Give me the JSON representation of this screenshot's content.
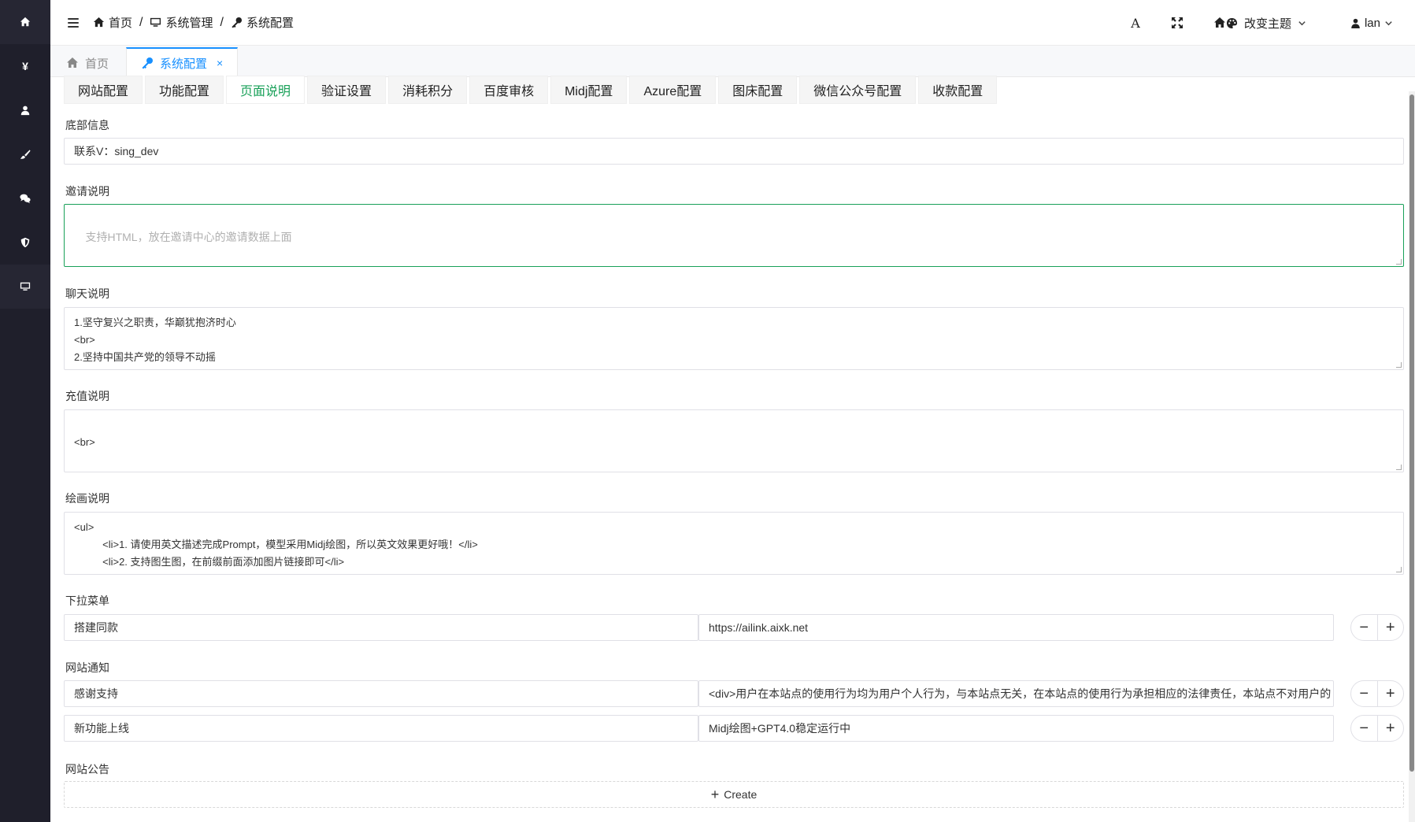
{
  "header": {
    "breadcrumb": [
      "首页",
      "系统管理",
      "系统配置"
    ],
    "theme_label": "改变主题",
    "user_label": "lan",
    "font_icon_glyph": "A"
  },
  "sidebar": {
    "yen_glyph": "¥"
  },
  "view_tabs": [
    {
      "label": "首页",
      "icon": "home-icon",
      "active": false
    },
    {
      "label": "系统配置",
      "icon": "key-icon",
      "active": true,
      "close": "×"
    }
  ],
  "config_tabs": [
    "网站配置",
    "功能配置",
    "页面说明",
    "验证设置",
    "消耗积分",
    "百度审核",
    "Midj配置",
    "Azure配置",
    "图床配置",
    "微信公众号配置",
    "收款配置"
  ],
  "form": {
    "footer_label": "底部信息",
    "footer_value": "联系V：sing_dev",
    "invite_label": "邀请说明",
    "invite_placeholder": "支持HTML，放在邀请中心的邀请数据上面",
    "chat_label": "聊天说明",
    "chat_value": "1.坚守复兴之职责，华巅犹抱济时心\n<br>\n2.坚持中国共产党的领导不动摇",
    "recharge_label": "充值说明",
    "recharge_value": "\n<br>",
    "draw_label": "绘画说明",
    "draw_value": "<ul>\n          <li>1. 请使用英文描述完成Prompt，模型采用Midj绘图，所以英文效果更好哦！</li>\n          <li>2. 支持图生图，在前缀前面添加图片链接即可</li>",
    "dropdown_label": "下拉菜单",
    "dropdown_rows": [
      {
        "key": "搭建同款",
        "value": "https://ailink.aixk.net"
      }
    ],
    "notice_label": "网站通知",
    "notice_rows": [
      {
        "key": "感谢支持",
        "value": "<div>用户在本站点的使用行为均为用户个人行为，与本站点无关，在本站点的使用行为承担相应的法律责任，本站点不对用户的"
      },
      {
        "key": "新功能上线",
        "value": "Midj绘图+GPT4.0稳定运行中"
      }
    ],
    "announce_label": "网站公告",
    "create_label": "Create",
    "minus": "−",
    "plus": "+"
  },
  "colors": {
    "accent_green": "#18a058",
    "accent_blue": "#1890ff",
    "sidebar_bg": "#1f1f2b"
  }
}
